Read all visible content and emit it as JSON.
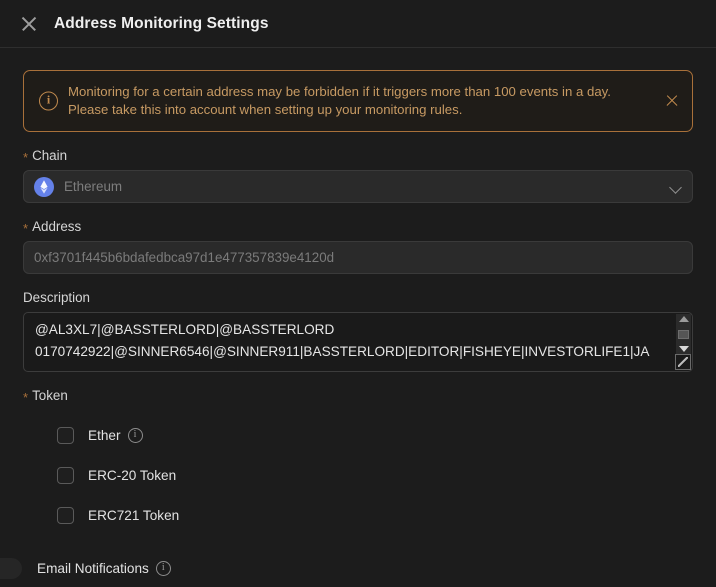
{
  "header": {
    "title": "Address Monitoring Settings",
    "close_icon": "close-icon"
  },
  "alert": {
    "icon": "info-circle-icon",
    "line1": "Monitoring for a certain address may be forbidden if it triggers more than 100 events in a day.",
    "line2": "Please take this into account when setting up your monitoring rules.",
    "close_icon": "close-icon",
    "border_color": "#a8703a",
    "text_color": "#c79a63"
  },
  "fields": {
    "chain": {
      "label": "Chain",
      "required_marker": "*",
      "value": "Ethereum",
      "network_icon": "ethereum-icon",
      "network_icon_color": "#6481e9",
      "chevron_icon": "chevron-down-icon"
    },
    "address": {
      "label": "Address",
      "required_marker": "*",
      "placeholder": "0xf3701f445b6bdafedbca97d1e477357839e4120d"
    },
    "description": {
      "label": "Description",
      "line1": "@AL3XL7|@BASSTERLORD|@BASSTERLORD",
      "line2": "0170742922|@SINNER6546|@SINNER911|BASSTERLORD|EDITOR|FISHEYE|INVESTORLIFE1|JA",
      "scroll_up_icon": "scroll-up-arrow-icon",
      "scroll_down_icon": "scroll-down-arrow-icon",
      "resize_icon": "resize-grip-icon"
    },
    "token": {
      "label": "Token",
      "required_marker": "*",
      "options": [
        {
          "label": "Ether",
          "checked": false,
          "info": true
        },
        {
          "label": "ERC-20 Token",
          "checked": false,
          "info": false
        },
        {
          "label": "ERC721 Token",
          "checked": false,
          "info": false
        }
      ]
    },
    "email_notifications": {
      "label": "Email Notifications",
      "enabled": false,
      "info": true
    }
  }
}
